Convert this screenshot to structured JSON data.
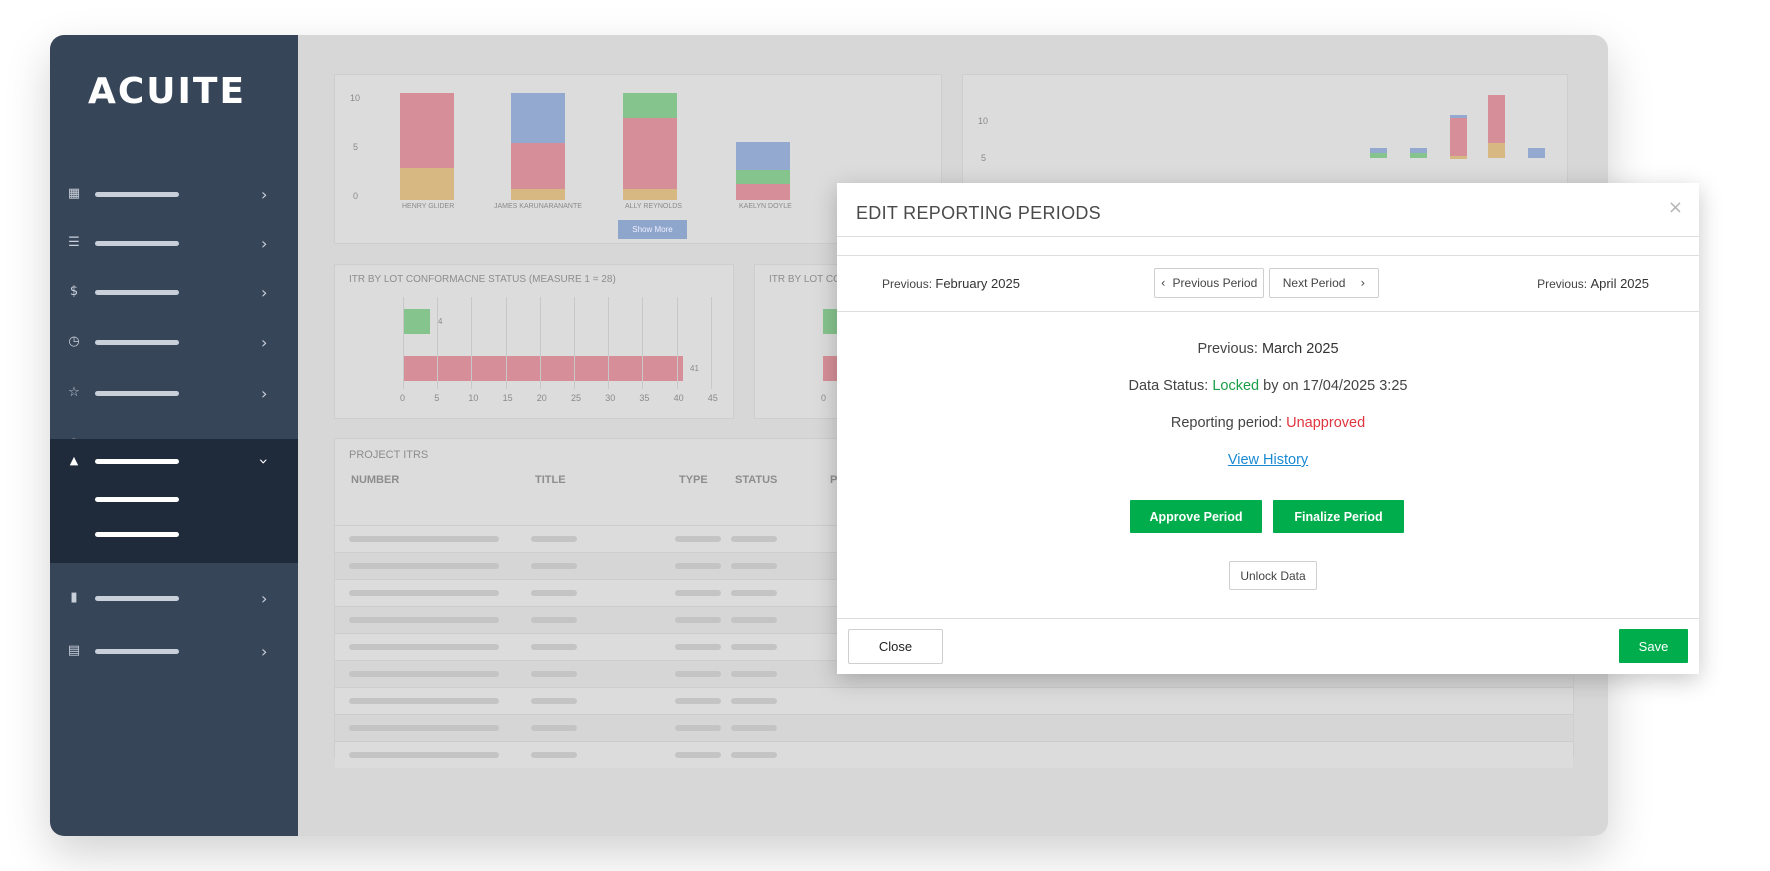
{
  "brand": {
    "logo_text": "ACUITE"
  },
  "sidebar": {
    "items": [
      {
        "icon": "dashboard-icon",
        "glyph": "▦"
      },
      {
        "icon": "list-icon",
        "glyph": "☰"
      },
      {
        "icon": "dollar-icon",
        "glyph": "$"
      },
      {
        "icon": "clock-icon",
        "glyph": "◷"
      },
      {
        "icon": "star-icon",
        "glyph": "☆"
      },
      {
        "icon": "help-icon",
        "glyph": "⊛"
      },
      {
        "icon": "warning-icon",
        "glyph": "▲",
        "active": true
      },
      {
        "icon": "file-icon",
        "glyph": "▮"
      },
      {
        "icon": "document-icon",
        "glyph": "▤"
      }
    ]
  },
  "background": {
    "chart1": {
      "y_ticks": [
        "10",
        "5",
        "0"
      ],
      "categories": [
        "HENRY GLIDER",
        "JAMES KARUNARANANTE",
        "ALLY REYNOLDS",
        "KAELYN DOYLE"
      ],
      "show_more": "Show More"
    },
    "chart2": {
      "y_ticks": [
        "10",
        "5"
      ]
    },
    "chart3": {
      "title": "ITR BY LOT CONFORMACNE STATUS (MEASURE 1 = 28)",
      "x_ticks": [
        "0",
        "5",
        "10",
        "15",
        "20",
        "25",
        "30",
        "35",
        "40",
        "45"
      ],
      "bar_labels": [
        "4",
        "41"
      ],
      "values": [
        4,
        41
      ]
    },
    "chart4": {
      "title": "ITR BY LOT CO",
      "x_ticks": [
        "0"
      ]
    },
    "table": {
      "title": "PROJECT ITRS",
      "headers": [
        "NUMBER",
        "TITLE",
        "TYPE",
        "STATUS",
        "PR"
      ]
    }
  },
  "modal": {
    "title": "EDIT REPORTING PERIODS",
    "prev_label": "Previous:",
    "prev_value": "February 2025",
    "next_label": "Previous:",
    "next_value": "April 2025",
    "prev_button": "Previous Period",
    "next_button": "Next Period",
    "current_label": "Previous:",
    "current_value": "March 2025",
    "data_status_label": "Data Status:",
    "data_status_value": "Locked",
    "data_status_suffix": "by on 17/04/2025 3:25",
    "reporting_label": "Reporting period:",
    "reporting_value": "Unapproved",
    "view_history": "View History",
    "approve": "Approve Period",
    "finalize": "Finalize Period",
    "unlock": "Unlock Data",
    "close": "Close",
    "save": "Save",
    "colors": {
      "green": "#00ad4c",
      "red": "#e0353e",
      "link": "#1a8ad2"
    }
  }
}
